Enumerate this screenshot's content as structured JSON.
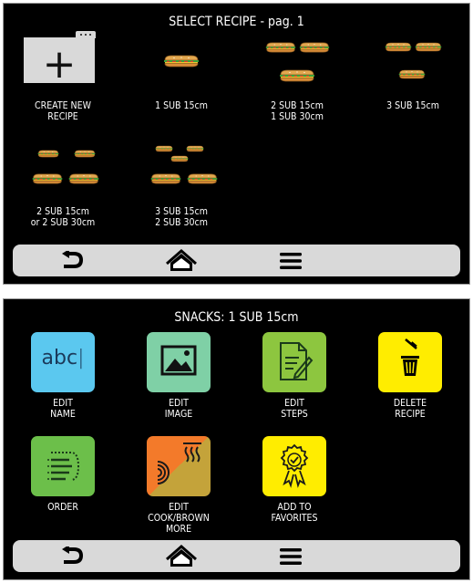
{
  "screen1": {
    "title": "SELECT RECIPE - pag. 1",
    "recipes": [
      {
        "label": "CREATE NEW\nRECIPE"
      },
      {
        "label": "1 SUB 15cm"
      },
      {
        "label": "2 SUB 15cm\n1 SUB 30cm"
      },
      {
        "label": "3 SUB 15cm"
      },
      {
        "label": "2 SUB 15cm\nor 2 SUB 30cm"
      },
      {
        "label": "3 SUB 15cm\n2 SUB 30cm"
      }
    ]
  },
  "screen2": {
    "title": "SNACKS: 1 SUB 15cm",
    "actions": [
      {
        "label": "EDIT\nNAME",
        "color": "#5bc8ef",
        "icon_text": "abc"
      },
      {
        "label": "EDIT\nIMAGE",
        "color": "#7fd0a6"
      },
      {
        "label": "EDIT\nSTEPS",
        "color": "#8dc63f"
      },
      {
        "label": "DELETE\nRECIPE",
        "color": "#ffed00"
      },
      {
        "label": "ORDER",
        "color": "#6cbf4a"
      },
      {
        "label": "EDIT\nCOOK/BROWN\nMORE",
        "color_a": "#c4a33a",
        "color_b": "#f37a2a"
      },
      {
        "label": "ADD TO\nFAVORITES",
        "color": "#ffed00"
      }
    ]
  },
  "navbar": [
    "back-icon",
    "home-icon",
    "menu-icon"
  ]
}
